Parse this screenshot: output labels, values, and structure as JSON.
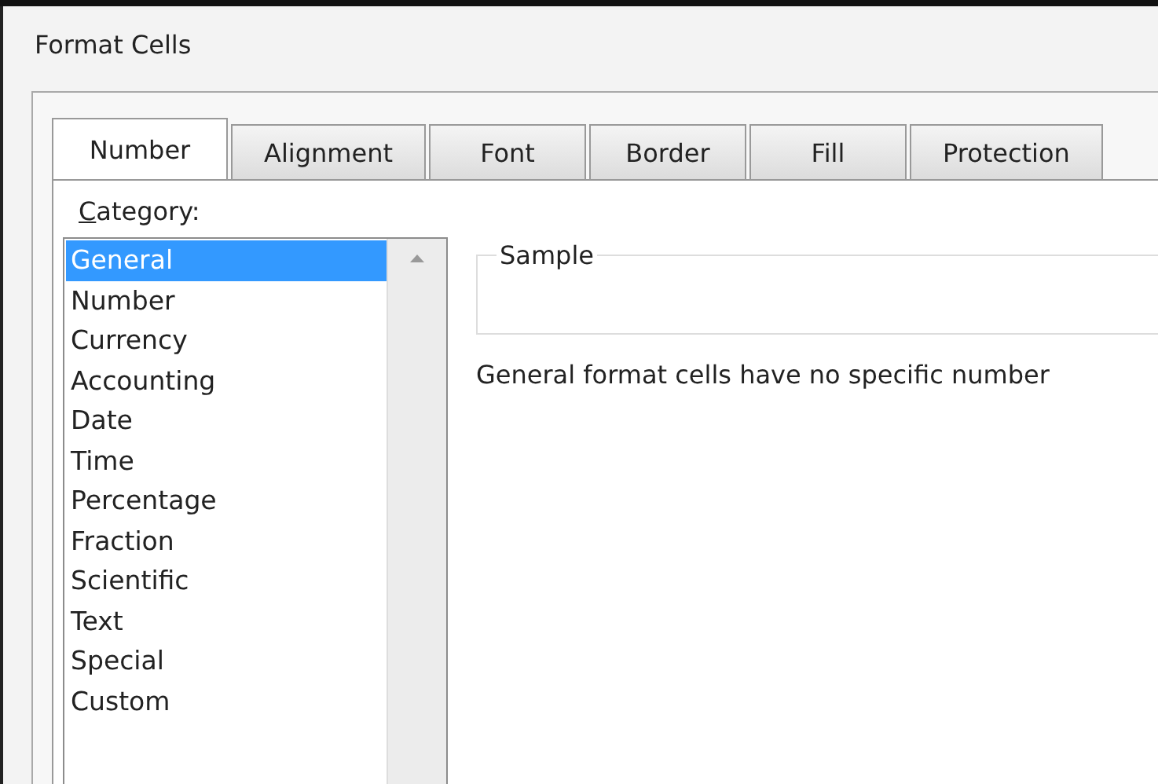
{
  "window": {
    "title": "Format Cells"
  },
  "tabs": [
    {
      "label": "Number",
      "selected": true
    },
    {
      "label": "Alignment",
      "selected": false
    },
    {
      "label": "Font",
      "selected": false
    },
    {
      "label": "Border",
      "selected": false
    },
    {
      "label": "Fill",
      "selected": false
    },
    {
      "label": "Protection",
      "selected": false
    }
  ],
  "category": {
    "label": "Category:",
    "items": [
      {
        "label": "General",
        "selected": true
      },
      {
        "label": "Number",
        "selected": false
      },
      {
        "label": "Currency",
        "selected": false
      },
      {
        "label": "Accounting",
        "selected": false
      },
      {
        "label": "Date",
        "selected": false
      },
      {
        "label": "Time",
        "selected": false
      },
      {
        "label": "Percentage",
        "selected": false
      },
      {
        "label": "Fraction",
        "selected": false
      },
      {
        "label": "Scientific",
        "selected": false
      },
      {
        "label": "Text",
        "selected": false
      },
      {
        "label": "Special",
        "selected": false
      },
      {
        "label": "Custom",
        "selected": false
      }
    ]
  },
  "sample": {
    "label": "Sample"
  },
  "description": "General format cells have no specific number"
}
